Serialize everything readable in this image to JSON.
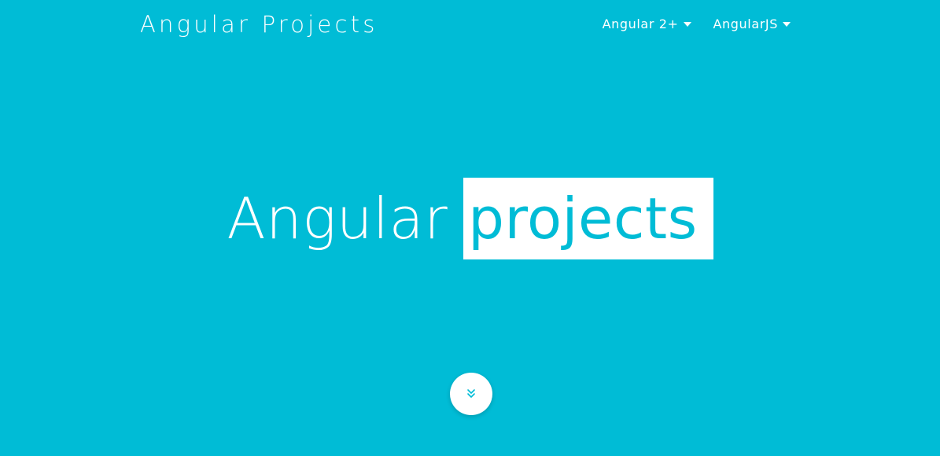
{
  "navbar": {
    "brand": "Angular Projects",
    "items": [
      {
        "label": "Angular 2+",
        "icon": "caret-down-icon"
      },
      {
        "label": "AngularJS",
        "icon": "caret-down-icon"
      }
    ]
  },
  "hero": {
    "title_plain": "Angular",
    "title_highlight": "projects"
  },
  "scroll_button": {
    "icon": "double-chevron-down-icon"
  },
  "colors": {
    "background": "#00bcd6",
    "text": "#ffffff",
    "highlight_background": "#ffffff",
    "highlight_text": "#00bcd6"
  }
}
